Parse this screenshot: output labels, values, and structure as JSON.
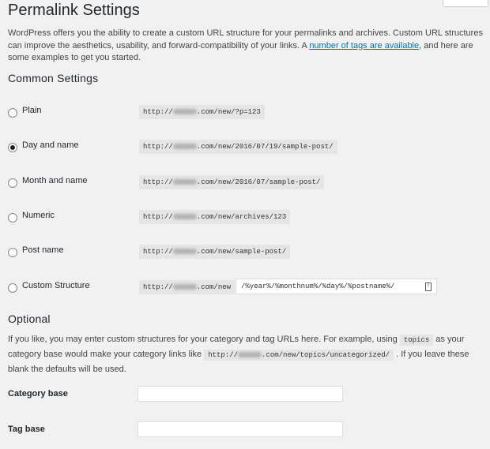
{
  "page": {
    "title": "Permalink Settings"
  },
  "intro": {
    "text_before": "WordPress offers you the ability to create a custom URL structure for your permalinks and archives. Custom URL structures can improve the aesthetics, usability, and forward-compatibility of your links. A ",
    "link_text": "number of tags are available",
    "text_after": ", and here are some examples to get you started."
  },
  "common": {
    "heading": "Common Settings",
    "url_prefix": "http://",
    "url_domain_suffix": ".com",
    "options": [
      {
        "label": "Plain",
        "path": "/new/?p=123",
        "checked": false
      },
      {
        "label": "Day and name",
        "path": "/new/2016/07/19/sample-post/",
        "checked": true
      },
      {
        "label": "Month and name",
        "path": "/new/2016/07/sample-post/",
        "checked": false
      },
      {
        "label": "Numeric",
        "path": "/new/archives/123",
        "checked": false
      },
      {
        "label": "Post name",
        "path": "/new/sample-post/",
        "checked": false
      },
      {
        "label": "Custom Structure",
        "path": "/new",
        "checked": false
      }
    ],
    "custom_structure_value": "/%year%/%monthnum%/%day%/%postname%/"
  },
  "optional": {
    "heading": "Optional",
    "text1": "If you like, you may enter custom structures for your category and tag URLs here. For example, using ",
    "code1": "topics",
    "text2": " as your category base would make your category links like ",
    "code2_prefix": "http://",
    "code2_suffix": ".com/new/topics/uncategorized/",
    "text3": " . If you leave these blank the defaults will be used.",
    "category_label": "Category base",
    "category_value": "",
    "tag_label": "Tag base",
    "tag_value": ""
  }
}
